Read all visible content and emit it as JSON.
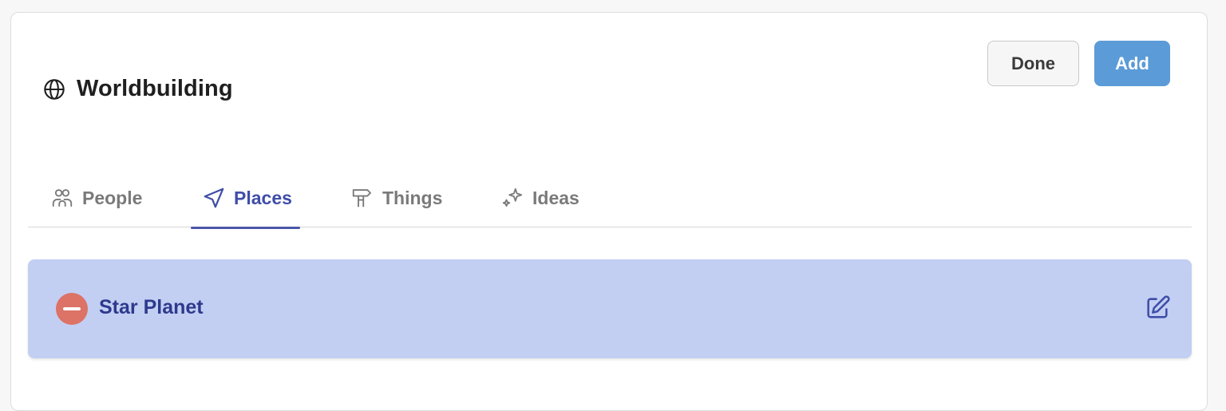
{
  "header": {
    "title": "Worldbuilding",
    "title_icon": "globe-icon",
    "done_label": "Done",
    "add_label": "Add"
  },
  "tabs": [
    {
      "label": "People",
      "icon": "people-icon",
      "active": false
    },
    {
      "label": "Places",
      "icon": "navigation-arrow-icon",
      "active": true
    },
    {
      "label": "Things",
      "icon": "things-icon",
      "active": false
    },
    {
      "label": "Ideas",
      "icon": "sparkles-icon",
      "active": false
    }
  ],
  "items": [
    {
      "name": "Star Planet",
      "remove_icon": "remove-icon",
      "edit_icon": "edit-icon"
    }
  ],
  "colors": {
    "accent": "#3f4ea8",
    "add_button": "#5b9bd8",
    "row_bg": "#c2cff3",
    "remove": "#dd7266"
  }
}
